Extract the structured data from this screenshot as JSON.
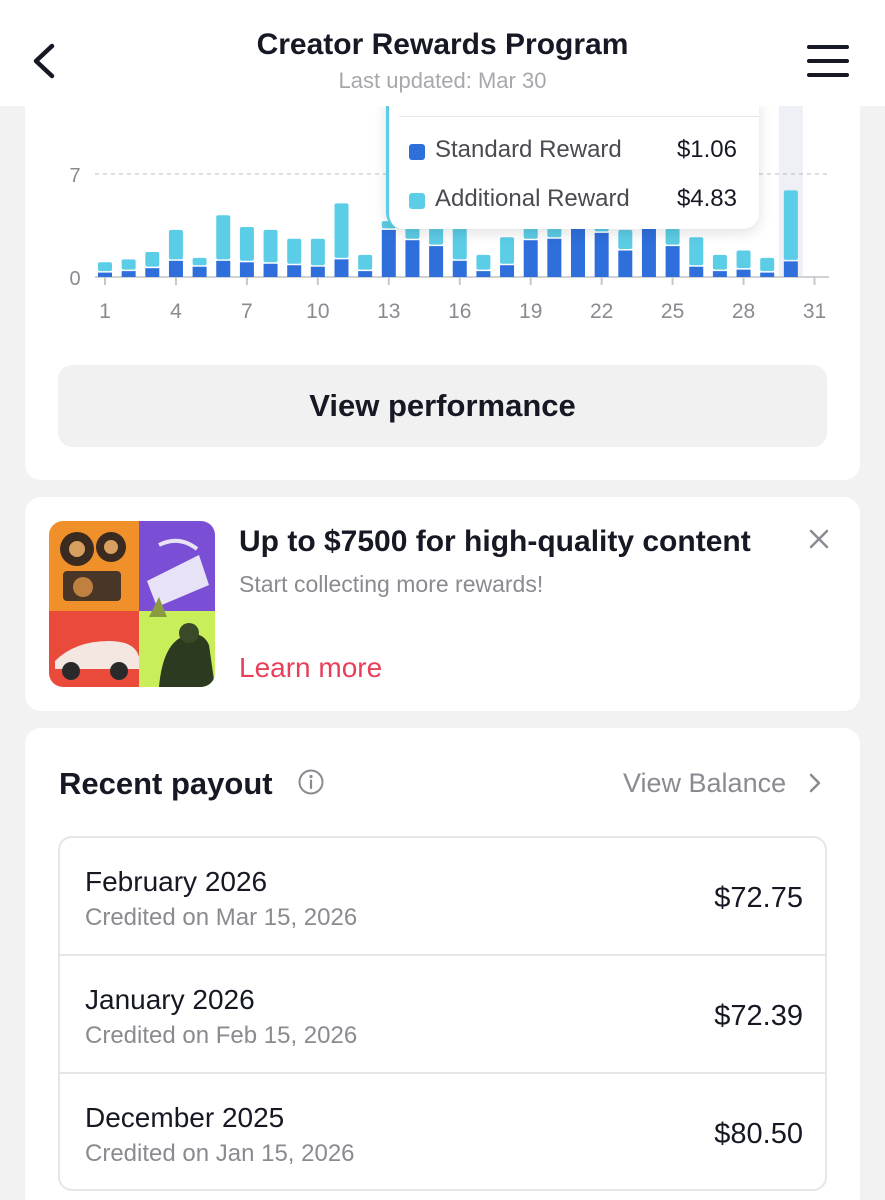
{
  "header": {
    "title": "Creator Rewards Program",
    "subtitle": "Last updated: Mar 30"
  },
  "chart_data": {
    "type": "bar",
    "stacked": true,
    "categories": [
      1,
      2,
      3,
      4,
      5,
      6,
      7,
      8,
      9,
      10,
      11,
      12,
      13,
      14,
      15,
      16,
      17,
      18,
      19,
      20,
      21,
      22,
      23,
      24,
      25,
      26,
      27,
      28,
      29,
      30,
      31
    ],
    "x_tick_labels": [
      "1",
      "4",
      "7",
      "10",
      "13",
      "16",
      "19",
      "22",
      "25",
      "28",
      "31"
    ],
    "y_tick_labels": [
      "0",
      "7"
    ],
    "ylim": [
      0,
      7
    ],
    "series": [
      {
        "name": "Standard Reward",
        "color": "#2f6fdc",
        "values": [
          0.3,
          0.4,
          0.6,
          1.1,
          0.7,
          1.1,
          1.0,
          0.9,
          0.8,
          0.7,
          1.2,
          0.4,
          3.2,
          2.5,
          2.1,
          1.1,
          0.4,
          0.8,
          2.5,
          2.6,
          3.7,
          3.0,
          1.8,
          3.5,
          2.1,
          0.7,
          0.4,
          0.5,
          0.3,
          1.06,
          null
        ]
      },
      {
        "name": "Additional Reward",
        "color": "#5ccde6",
        "values": [
          0.7,
          0.8,
          1.1,
          2.1,
          0.6,
          3.1,
          2.4,
          2.3,
          1.8,
          1.9,
          3.8,
          1.1,
          0.6,
          1.5,
          1.9,
          2.9,
          1.1,
          1.9,
          1.2,
          0.8,
          0.6,
          0.7,
          1.4,
          0.5,
          1.2,
          2.0,
          1.1,
          1.3,
          1.0,
          4.83,
          null
        ]
      }
    ],
    "tooltip": {
      "items": [
        {
          "label": "Standard Reward",
          "value": "$1.06",
          "color": "#2f6fdc"
        },
        {
          "label": "Additional Reward",
          "value": "$4.83",
          "color": "#5ccde6"
        }
      ]
    }
  },
  "view_performance_label": "View performance",
  "promo": {
    "title": "Up to $7500 for high-quality content",
    "subtitle": "Start collecting more rewards!",
    "link": "Learn more"
  },
  "payout": {
    "title": "Recent payout",
    "view_balance": "View Balance",
    "rows": [
      {
        "month": "February 2026",
        "credited": "Credited on Mar 15, 2026",
        "amount": "$72.75"
      },
      {
        "month": "January 2026",
        "credited": "Credited on Feb 15, 2026",
        "amount": "$72.39"
      },
      {
        "month": "December 2025",
        "credited": "Credited on Jan 15, 2026",
        "amount": "$80.50"
      }
    ]
  }
}
